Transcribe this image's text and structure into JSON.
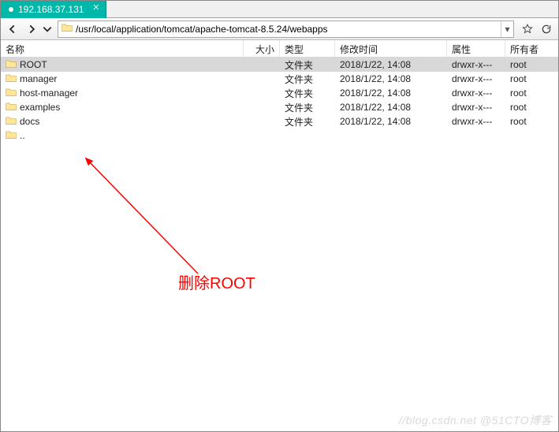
{
  "tab": {
    "title": "192.168.37.131"
  },
  "address": {
    "path": "/usr/local/application/tomcat/apache-tomcat-8.5.24/webapps"
  },
  "columns": {
    "name": "名称",
    "size": "大小",
    "type": "类型",
    "mtime": "修改时间",
    "attr": "属性",
    "owner": "所有者"
  },
  "rows": [
    {
      "name": "..",
      "size": "",
      "type": "",
      "mtime": "",
      "attr": "",
      "owner": "",
      "icon": "folder",
      "selected": false
    },
    {
      "name": "docs",
      "size": "",
      "type": "文件夹",
      "mtime": "2018/1/22, 14:08",
      "attr": "drwxr-x---",
      "owner": "root",
      "icon": "folder",
      "selected": false
    },
    {
      "name": "examples",
      "size": "",
      "type": "文件夹",
      "mtime": "2018/1/22, 14:08",
      "attr": "drwxr-x---",
      "owner": "root",
      "icon": "folder",
      "selected": false
    },
    {
      "name": "host-manager",
      "size": "",
      "type": "文件夹",
      "mtime": "2018/1/22, 14:08",
      "attr": "drwxr-x---",
      "owner": "root",
      "icon": "folder",
      "selected": false
    },
    {
      "name": "manager",
      "size": "",
      "type": "文件夹",
      "mtime": "2018/1/22, 14:08",
      "attr": "drwxr-x---",
      "owner": "root",
      "icon": "folder",
      "selected": false
    },
    {
      "name": "ROOT",
      "size": "",
      "type": "文件夹",
      "mtime": "2018/1/22, 14:08",
      "attr": "drwxr-x---",
      "owner": "root",
      "icon": "folder",
      "selected": true
    }
  ],
  "annotation": {
    "text": "删除ROOT"
  },
  "watermark": "//blog.csdn.net @51CTO博客"
}
